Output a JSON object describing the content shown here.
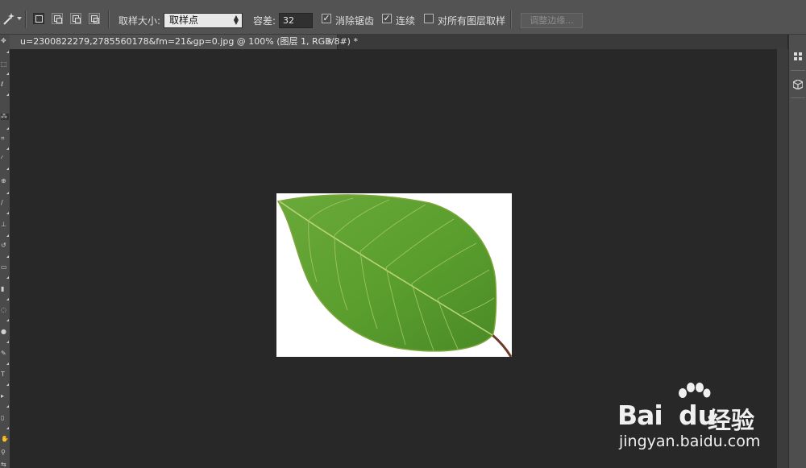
{
  "options_bar": {
    "sample_size_label": "取样大小:",
    "sample_size_value": "取样点",
    "tolerance_label": "容差:",
    "tolerance_value": "32",
    "anti_alias_label": "消除锯齿",
    "anti_alias_checked": true,
    "contiguous_label": "连续",
    "contiguous_checked": true,
    "sample_all_layers_label": "对所有图层取样",
    "sample_all_layers_checked": false,
    "refine_edge_label": "调整边缘..."
  },
  "document_tab": {
    "title": "u=2300822279,2785560178&fm=21&gp=0.jpg @ 100% (图层 1, RGB/8#) *",
    "close": "×"
  },
  "icons": {
    "magic_wand": "magic-wand-icon",
    "leaf": "leaf-photo",
    "baidu_paw": "baidu-paw-icon"
  },
  "colors": {
    "canvas_bg": "#282828",
    "ui_panel": "#535353",
    "leaf_green": "#5a9e2e",
    "watermark": "#f0f0f0"
  },
  "watermark": {
    "brand_left": "Bai",
    "brand_du": "du",
    "brand_cn": "经验",
    "url": "jingyan.baidu.com"
  }
}
